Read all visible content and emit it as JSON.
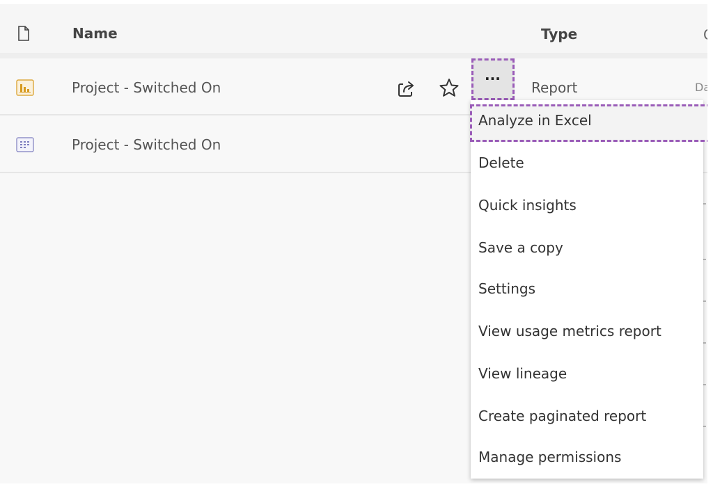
{
  "table": {
    "columns": {
      "name": "Name",
      "type": "Type"
    },
    "rows": [
      {
        "name": "Project - Switched On",
        "type": "Report",
        "icon": "report-icon",
        "extra": "Da"
      },
      {
        "name": "Project - Switched On",
        "icon": "dataset-icon"
      }
    ]
  },
  "actions": {
    "more_label": "···"
  },
  "context_menu": {
    "items": [
      "Analyze in Excel",
      "Delete",
      "Quick insights",
      "Save a copy",
      "Settings",
      "View usage metrics report",
      "View lineage",
      "Create paginated report",
      "Manage permissions"
    ]
  },
  "colors": {
    "highlight_border": "#9a5cb8",
    "report_icon": "#d79a1e",
    "dataset_icon": "#7f7fbf"
  }
}
